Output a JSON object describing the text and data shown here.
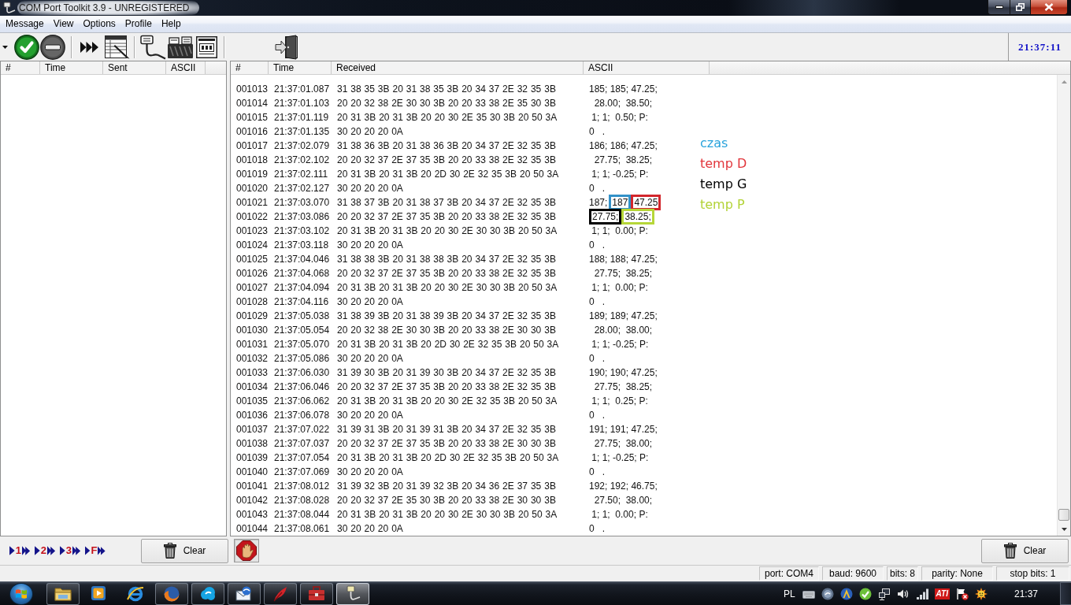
{
  "window": {
    "title": "COM Port Toolkit 3.9 - UNREGISTERED"
  },
  "menu": [
    "Message",
    "View",
    "Options",
    "Profile",
    "Help"
  ],
  "toolbar": {
    "clock": "21:37:11"
  },
  "sent_table": {
    "columns": [
      "#",
      "Time",
      "Sent",
      "ASCII"
    ]
  },
  "received_table": {
    "columns": [
      "#",
      "Time",
      "Received",
      "ASCII"
    ],
    "rows": [
      {
        "index": "001013",
        "time": "21:37:01.087",
        "received": "31 38 35 3B 20 31 38 35 3B 20 34 37 2E 32 35 3B",
        "ascii": "185; 185; 47.25;"
      },
      {
        "index": "001014",
        "time": "21:37:01.103",
        "received": "20 20 32 38 2E 30 30 3B 20 20 33 38 2E 35 30 3B",
        "ascii": "  28.00;  38.50;"
      },
      {
        "index": "001015",
        "time": "21:37:01.119",
        "received": "20 31 3B 20 31 3B 20 20 30 2E 35 30 3B 20 50 3A",
        "ascii": " 1; 1;  0.50; P:"
      },
      {
        "index": "001016",
        "time": "21:37:01.135",
        "received": "30 20 20 20 0A",
        "ascii": "0   ."
      },
      {
        "index": "001017",
        "time": "21:37:02.079",
        "received": "31 38 36 3B 20 31 38 36 3B 20 34 37 2E 32 35 3B",
        "ascii": "186; 186; 47.25;"
      },
      {
        "index": "001018",
        "time": "21:37:02.102",
        "received": "20 20 32 37 2E 37 35 3B 20 20 33 38 2E 32 35 3B",
        "ascii": "  27.75;  38.25;"
      },
      {
        "index": "001019",
        "time": "21:37:02.111",
        "received": "20 31 3B 20 31 3B 20 2D 30 2E 32 35 3B 20 50 3A",
        "ascii": " 1; 1; -0.25; P:"
      },
      {
        "index": "001020",
        "time": "21:37:02.127",
        "received": "30 20 20 20 0A",
        "ascii": "0   ."
      },
      {
        "index": "001021",
        "time": "21:37:03.070",
        "received": "31 38 37 3B 20 31 38 37 3B 20 34 37 2E 32 35 3B",
        "ascii_parts": [
          {
            "text": "187;"
          },
          {
            "text": "187",
            "color": "#3391c8"
          },
          {
            "text": "47.25",
            "color": "#d2262c"
          }
        ]
      },
      {
        "index": "001022",
        "time": "21:37:03.086",
        "received": "20 20 32 37 2E 37 35 3B 20 20 33 38 2E 32 35 3B",
        "ascii_parts": [
          {
            "text": "27.75;",
            "color": "#000000"
          },
          {
            "text": "38.25;",
            "color": "#b6d638"
          }
        ]
      },
      {
        "index": "001023",
        "time": "21:37:03.102",
        "received": "20 31 3B 20 31 3B 20 20 30 2E 30 30 3B 20 50 3A",
        "ascii": " 1; 1;  0.00; P:"
      },
      {
        "index": "001024",
        "time": "21:37:03.118",
        "received": "30 20 20 20 0A",
        "ascii": "0   ."
      },
      {
        "index": "001025",
        "time": "21:37:04.046",
        "received": "31 38 38 3B 20 31 38 38 3B 20 34 37 2E 32 35 3B",
        "ascii": "188; 188; 47.25;"
      },
      {
        "index": "001026",
        "time": "21:37:04.068",
        "received": "20 20 32 37 2E 37 35 3B 20 20 33 38 2E 32 35 3B",
        "ascii": "  27.75;  38.25;"
      },
      {
        "index": "001027",
        "time": "21:37:04.094",
        "received": "20 31 3B 20 31 3B 20 20 30 2E 30 30 3B 20 50 3A",
        "ascii": " 1; 1;  0.00; P:"
      },
      {
        "index": "001028",
        "time": "21:37:04.116",
        "received": "30 20 20 20 0A",
        "ascii": "0   ."
      },
      {
        "index": "001029",
        "time": "21:37:05.038",
        "received": "31 38 39 3B 20 31 38 39 3B 20 34 37 2E 32 35 3B",
        "ascii": "189; 189; 47.25;"
      },
      {
        "index": "001030",
        "time": "21:37:05.054",
        "received": "20 20 32 38 2E 30 30 3B 20 20 33 38 2E 30 30 3B",
        "ascii": "  28.00;  38.00;"
      },
      {
        "index": "001031",
        "time": "21:37:05.070",
        "received": "20 31 3B 20 31 3B 20 2D 30 2E 32 35 3B 20 50 3A",
        "ascii": " 1; 1; -0.25; P:"
      },
      {
        "index": "001032",
        "time": "21:37:05.086",
        "received": "30 20 20 20 0A",
        "ascii": "0   ."
      },
      {
        "index": "001033",
        "time": "21:37:06.030",
        "received": "31 39 30 3B 20 31 39 30 3B 20 34 37 2E 32 35 3B",
        "ascii": "190; 190; 47.25;"
      },
      {
        "index": "001034",
        "time": "21:37:06.046",
        "received": "20 20 32 37 2E 37 35 3B 20 20 33 38 2E 32 35 3B",
        "ascii": "  27.75;  38.25;"
      },
      {
        "index": "001035",
        "time": "21:37:06.062",
        "received": "20 31 3B 20 31 3B 20 20 30 2E 32 35 3B 20 50 3A",
        "ascii": " 1; 1;  0.25; P:"
      },
      {
        "index": "001036",
        "time": "21:37:06.078",
        "received": "30 20 20 20 0A",
        "ascii": "0   ."
      },
      {
        "index": "001037",
        "time": "21:37:07.022",
        "received": "31 39 31 3B 20 31 39 31 3B 20 34 37 2E 32 35 3B",
        "ascii": "191; 191; 47.25;"
      },
      {
        "index": "001038",
        "time": "21:37:07.037",
        "received": "20 20 32 37 2E 37 35 3B 20 20 33 38 2E 30 30 3B",
        "ascii": "  27.75;  38.00;"
      },
      {
        "index": "001039",
        "time": "21:37:07.054",
        "received": "20 31 3B 20 31 3B 20 2D 30 2E 32 35 3B 20 50 3A",
        "ascii": " 1; 1; -0.25; P:"
      },
      {
        "index": "001040",
        "time": "21:37:07.069",
        "received": "30 20 20 20 0A",
        "ascii": "0   ."
      },
      {
        "index": "001041",
        "time": "21:37:08.012",
        "received": "31 39 32 3B 20 31 39 32 3B 20 34 36 2E 37 35 3B",
        "ascii": "192; 192; 46.75;"
      },
      {
        "index": "001042",
        "time": "21:37:08.028",
        "received": "20 20 32 37 2E 35 30 3B 20 20 33 38 2E 30 30 3B",
        "ascii": "  27.50;  38.00;"
      },
      {
        "index": "001043",
        "time": "21:37:08.044",
        "received": "20 31 3B 20 31 3B 20 20 30 2E 30 30 3B 20 50 3A",
        "ascii": " 1; 1;  0.00; P:"
      },
      {
        "index": "001044",
        "time": "21:37:08.061",
        "received": "30 20 20 20 0A",
        "ascii": "0   ."
      }
    ]
  },
  "annotations": [
    {
      "label": "czas",
      "color": "#29a3dc"
    },
    {
      "label": "temp D",
      "color": "#e2363c"
    },
    {
      "label": "temp G",
      "color": "#000000"
    },
    {
      "label": "temp P",
      "color": "#b3d337"
    }
  ],
  "send_panel": {
    "macros": [
      {
        "label": "1"
      },
      {
        "label": "2"
      },
      {
        "label": "3"
      },
      {
        "label": "F"
      }
    ],
    "clear_button": "Clear"
  },
  "receive_panel": {
    "clear_button": "Clear"
  },
  "status_bar": [
    "port: COM4",
    "baud: 9600",
    "bits: 8",
    "parity: None",
    "stop bits: 1"
  ],
  "taskbar": {
    "apps": [
      {
        "kind": "folder",
        "running": true,
        "selected": false
      },
      {
        "kind": "media",
        "running": false,
        "selected": false
      },
      {
        "kind": "ring",
        "running": false,
        "selected": false
      },
      {
        "kind": "globe",
        "running": true,
        "selected": false
      },
      {
        "kind": "cloud",
        "running": true,
        "selected": false
      },
      {
        "kind": "envelope",
        "running": true,
        "selected": false
      },
      {
        "kind": "feather",
        "running": true,
        "selected": false
      },
      {
        "kind": "toolbox",
        "running": true,
        "selected": false
      },
      {
        "kind": "cable",
        "running": true,
        "selected": true
      }
    ],
    "language": "PL",
    "tray_logo": "ATI",
    "clock": "21:37"
  }
}
